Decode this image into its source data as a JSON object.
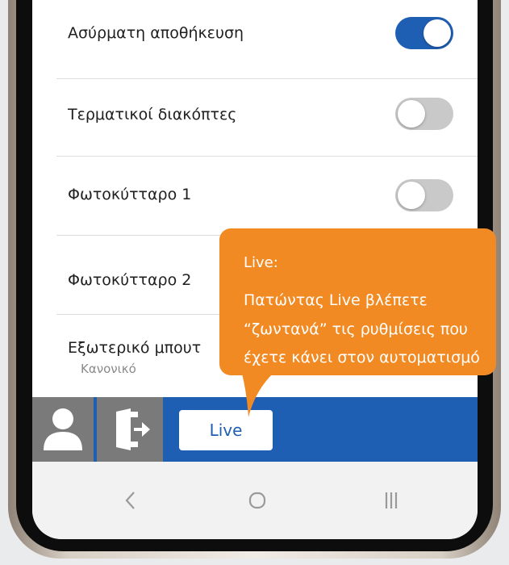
{
  "settings": [
    {
      "label": "Ασύρματη αποθήκευση",
      "toggle": "on"
    },
    {
      "label": "Τερματικοί διακόπτες",
      "toggle": "off"
    },
    {
      "label": "Φωτοκύτταρο 1",
      "toggle": "off"
    },
    {
      "label": "Φωτοκύτταρο 2"
    },
    {
      "label": "Εξωτερικό μπουτ",
      "sublabel": "Κανονικό"
    }
  ],
  "bottom_bar": {
    "profile_icon": "person-icon",
    "logout_icon": "door-exit-icon",
    "live_label": "Live"
  },
  "nav_bar": {
    "back_icon": "chevron-left-icon",
    "home_icon": "home-circle-icon",
    "recents_icon": "recents-lines-icon"
  },
  "callout": {
    "title": "Live:",
    "lines": [
      "Πατώντας Live βλέπετε",
      "“ζωντανά” τις ρυθμίσεις που",
      "έχετε κάνει στον αυτοματισμό"
    ]
  },
  "colors": {
    "accent_blue": "#1f5fb3",
    "callout_orange": "#f28a23",
    "toggle_off": "#c9c9c9",
    "bar_gray": "#7a7a7a"
  }
}
